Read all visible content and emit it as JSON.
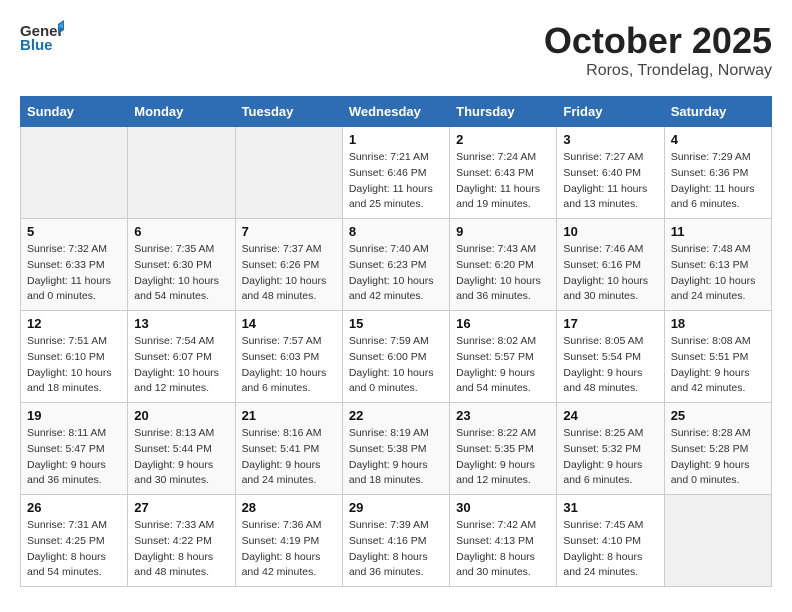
{
  "header": {
    "logo_general": "General",
    "logo_blue": "Blue",
    "month": "October 2025",
    "location": "Roros, Trondelag, Norway"
  },
  "weekdays": [
    "Sunday",
    "Monday",
    "Tuesday",
    "Wednesday",
    "Thursday",
    "Friday",
    "Saturday"
  ],
  "weeks": [
    [
      {
        "day": "",
        "sunrise": "",
        "sunset": "",
        "daylight": ""
      },
      {
        "day": "",
        "sunrise": "",
        "sunset": "",
        "daylight": ""
      },
      {
        "day": "",
        "sunrise": "",
        "sunset": "",
        "daylight": ""
      },
      {
        "day": "1",
        "sunrise": "Sunrise: 7:21 AM",
        "sunset": "Sunset: 6:46 PM",
        "daylight": "Daylight: 11 hours and 25 minutes."
      },
      {
        "day": "2",
        "sunrise": "Sunrise: 7:24 AM",
        "sunset": "Sunset: 6:43 PM",
        "daylight": "Daylight: 11 hours and 19 minutes."
      },
      {
        "day": "3",
        "sunrise": "Sunrise: 7:27 AM",
        "sunset": "Sunset: 6:40 PM",
        "daylight": "Daylight: 11 hours and 13 minutes."
      },
      {
        "day": "4",
        "sunrise": "Sunrise: 7:29 AM",
        "sunset": "Sunset: 6:36 PM",
        "daylight": "Daylight: 11 hours and 6 minutes."
      }
    ],
    [
      {
        "day": "5",
        "sunrise": "Sunrise: 7:32 AM",
        "sunset": "Sunset: 6:33 PM",
        "daylight": "Daylight: 11 hours and 0 minutes."
      },
      {
        "day": "6",
        "sunrise": "Sunrise: 7:35 AM",
        "sunset": "Sunset: 6:30 PM",
        "daylight": "Daylight: 10 hours and 54 minutes."
      },
      {
        "day": "7",
        "sunrise": "Sunrise: 7:37 AM",
        "sunset": "Sunset: 6:26 PM",
        "daylight": "Daylight: 10 hours and 48 minutes."
      },
      {
        "day": "8",
        "sunrise": "Sunrise: 7:40 AM",
        "sunset": "Sunset: 6:23 PM",
        "daylight": "Daylight: 10 hours and 42 minutes."
      },
      {
        "day": "9",
        "sunrise": "Sunrise: 7:43 AM",
        "sunset": "Sunset: 6:20 PM",
        "daylight": "Daylight: 10 hours and 36 minutes."
      },
      {
        "day": "10",
        "sunrise": "Sunrise: 7:46 AM",
        "sunset": "Sunset: 6:16 PM",
        "daylight": "Daylight: 10 hours and 30 minutes."
      },
      {
        "day": "11",
        "sunrise": "Sunrise: 7:48 AM",
        "sunset": "Sunset: 6:13 PM",
        "daylight": "Daylight: 10 hours and 24 minutes."
      }
    ],
    [
      {
        "day": "12",
        "sunrise": "Sunrise: 7:51 AM",
        "sunset": "Sunset: 6:10 PM",
        "daylight": "Daylight: 10 hours and 18 minutes."
      },
      {
        "day": "13",
        "sunrise": "Sunrise: 7:54 AM",
        "sunset": "Sunset: 6:07 PM",
        "daylight": "Daylight: 10 hours and 12 minutes."
      },
      {
        "day": "14",
        "sunrise": "Sunrise: 7:57 AM",
        "sunset": "Sunset: 6:03 PM",
        "daylight": "Daylight: 10 hours and 6 minutes."
      },
      {
        "day": "15",
        "sunrise": "Sunrise: 7:59 AM",
        "sunset": "Sunset: 6:00 PM",
        "daylight": "Daylight: 10 hours and 0 minutes."
      },
      {
        "day": "16",
        "sunrise": "Sunrise: 8:02 AM",
        "sunset": "Sunset: 5:57 PM",
        "daylight": "Daylight: 9 hours and 54 minutes."
      },
      {
        "day": "17",
        "sunrise": "Sunrise: 8:05 AM",
        "sunset": "Sunset: 5:54 PM",
        "daylight": "Daylight: 9 hours and 48 minutes."
      },
      {
        "day": "18",
        "sunrise": "Sunrise: 8:08 AM",
        "sunset": "Sunset: 5:51 PM",
        "daylight": "Daylight: 9 hours and 42 minutes."
      }
    ],
    [
      {
        "day": "19",
        "sunrise": "Sunrise: 8:11 AM",
        "sunset": "Sunset: 5:47 PM",
        "daylight": "Daylight: 9 hours and 36 minutes."
      },
      {
        "day": "20",
        "sunrise": "Sunrise: 8:13 AM",
        "sunset": "Sunset: 5:44 PM",
        "daylight": "Daylight: 9 hours and 30 minutes."
      },
      {
        "day": "21",
        "sunrise": "Sunrise: 8:16 AM",
        "sunset": "Sunset: 5:41 PM",
        "daylight": "Daylight: 9 hours and 24 minutes."
      },
      {
        "day": "22",
        "sunrise": "Sunrise: 8:19 AM",
        "sunset": "Sunset: 5:38 PM",
        "daylight": "Daylight: 9 hours and 18 minutes."
      },
      {
        "day": "23",
        "sunrise": "Sunrise: 8:22 AM",
        "sunset": "Sunset: 5:35 PM",
        "daylight": "Daylight: 9 hours and 12 minutes."
      },
      {
        "day": "24",
        "sunrise": "Sunrise: 8:25 AM",
        "sunset": "Sunset: 5:32 PM",
        "daylight": "Daylight: 9 hours and 6 minutes."
      },
      {
        "day": "25",
        "sunrise": "Sunrise: 8:28 AM",
        "sunset": "Sunset: 5:28 PM",
        "daylight": "Daylight: 9 hours and 0 minutes."
      }
    ],
    [
      {
        "day": "26",
        "sunrise": "Sunrise: 7:31 AM",
        "sunset": "Sunset: 4:25 PM",
        "daylight": "Daylight: 8 hours and 54 minutes."
      },
      {
        "day": "27",
        "sunrise": "Sunrise: 7:33 AM",
        "sunset": "Sunset: 4:22 PM",
        "daylight": "Daylight: 8 hours and 48 minutes."
      },
      {
        "day": "28",
        "sunrise": "Sunrise: 7:36 AM",
        "sunset": "Sunset: 4:19 PM",
        "daylight": "Daylight: 8 hours and 42 minutes."
      },
      {
        "day": "29",
        "sunrise": "Sunrise: 7:39 AM",
        "sunset": "Sunset: 4:16 PM",
        "daylight": "Daylight: 8 hours and 36 minutes."
      },
      {
        "day": "30",
        "sunrise": "Sunrise: 7:42 AM",
        "sunset": "Sunset: 4:13 PM",
        "daylight": "Daylight: 8 hours and 30 minutes."
      },
      {
        "day": "31",
        "sunrise": "Sunrise: 7:45 AM",
        "sunset": "Sunset: 4:10 PM",
        "daylight": "Daylight: 8 hours and 24 minutes."
      },
      {
        "day": "",
        "sunrise": "",
        "sunset": "",
        "daylight": ""
      }
    ]
  ]
}
